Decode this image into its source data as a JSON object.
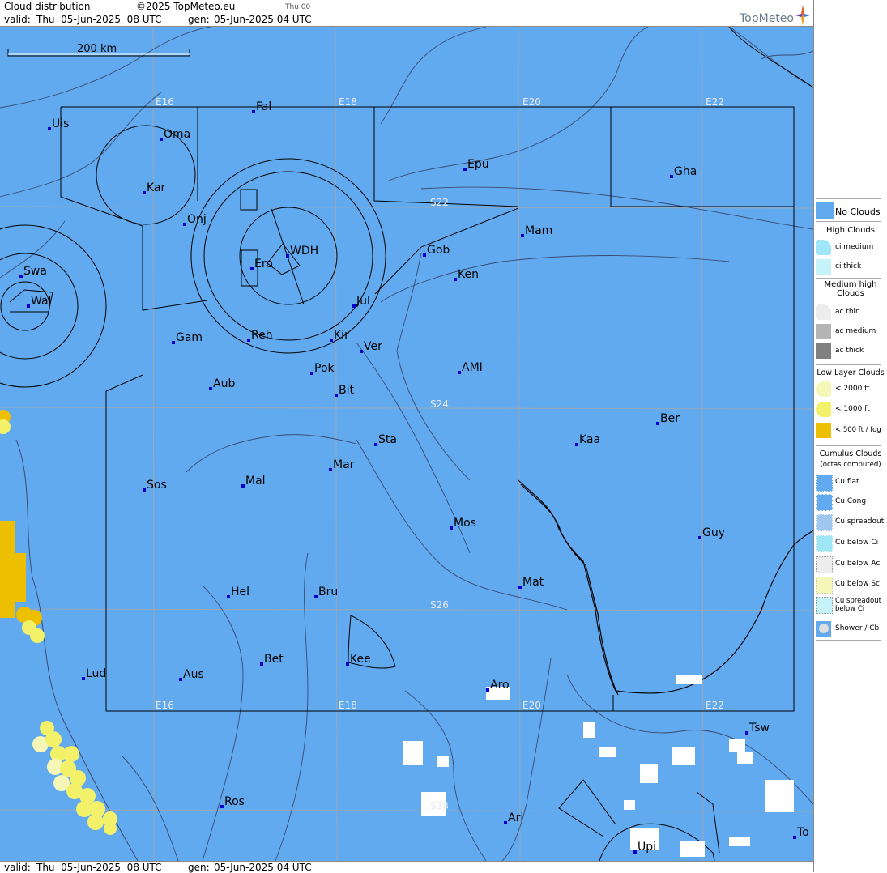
{
  "header": {
    "title": "Cloud distribution",
    "copyright": "©2025 TopMeteo.eu",
    "day_tag": "Thu 00",
    "valid_label": "valid:",
    "valid_value": "Thu  05-Jun-2025  08 UTC",
    "gen_label": "gen:",
    "gen_value": "05-Jun-2025 04 UTC",
    "logo": "TopMeteo"
  },
  "footer": {
    "valid_label": "valid:",
    "valid_value": "Thu  05-Jun-2025  08 UTC",
    "gen_label": "gen:",
    "gen_value": "05-Jun-2025 04 UTC"
  },
  "map": {
    "scale_label": "200 km",
    "grid_labels": [
      "E16",
      "E18",
      "E20",
      "E22",
      "S22",
      "S24",
      "S26",
      "S28"
    ],
    "stations": [
      "Uis",
      "Fal",
      "Oma",
      "Kar",
      "Epu",
      "Gha",
      "Onj",
      "Mam",
      "Gob",
      "Swa",
      "WDH",
      "Ero",
      "Ken",
      "Wal",
      "Jul",
      "Gam",
      "Reh",
      "Kir",
      "Ver",
      "Pok",
      "AMI",
      "Aub",
      "Bit",
      "Ber",
      "Sta",
      "Kaa",
      "Mar",
      "Sos",
      "Mal",
      "Mos",
      "Guy",
      "Mat",
      "Hel",
      "Bru",
      "Bet",
      "Kee",
      "Lud",
      "Aus",
      "Aro",
      "Tsw",
      "Ros",
      "Ari",
      "To",
      "Upi"
    ]
  },
  "legend": {
    "no_clouds": "No Clouds",
    "high_header": "High Clouds",
    "ci_medium": "ci medium",
    "ci_thick": "ci thick",
    "medium_header": "Medium high Clouds",
    "ac_thin": "ac thin",
    "ac_medium": "ac medium",
    "ac_thick": "ac thick",
    "low_header": "Low Layer Clouds",
    "low_2000": "< 2000 ft",
    "low_1000": "< 1000 ft",
    "low_500": "< 500 ft / fog",
    "cumulus_header": "Cumulus Clouds",
    "cumulus_sub": "(octas computed)",
    "cu_flat": "Cu flat",
    "cu_cong": "Cu Cong",
    "cu_spreadout": "Cu spreadout",
    "cu_below_ci": "Cu below Ci",
    "cu_below_ac": "Cu below Ac",
    "cu_below_sc": "Cu below Sc",
    "cu_spreadout_below_ci": "Cu spreadout below Ci",
    "shower_cb": "Shower / Cb"
  },
  "colors": {
    "no_clouds": "#62aaf0",
    "ci_medium": "#9fe6f7",
    "ci_thick": "#c6f2fa",
    "ac_thin": "#ededed",
    "ac_medium": "#b4b4b4",
    "ac_thick": "#808080",
    "low_2000": "#f5f7b8",
    "low_1000": "#f3f06a",
    "low_500": "#ecc000"
  }
}
